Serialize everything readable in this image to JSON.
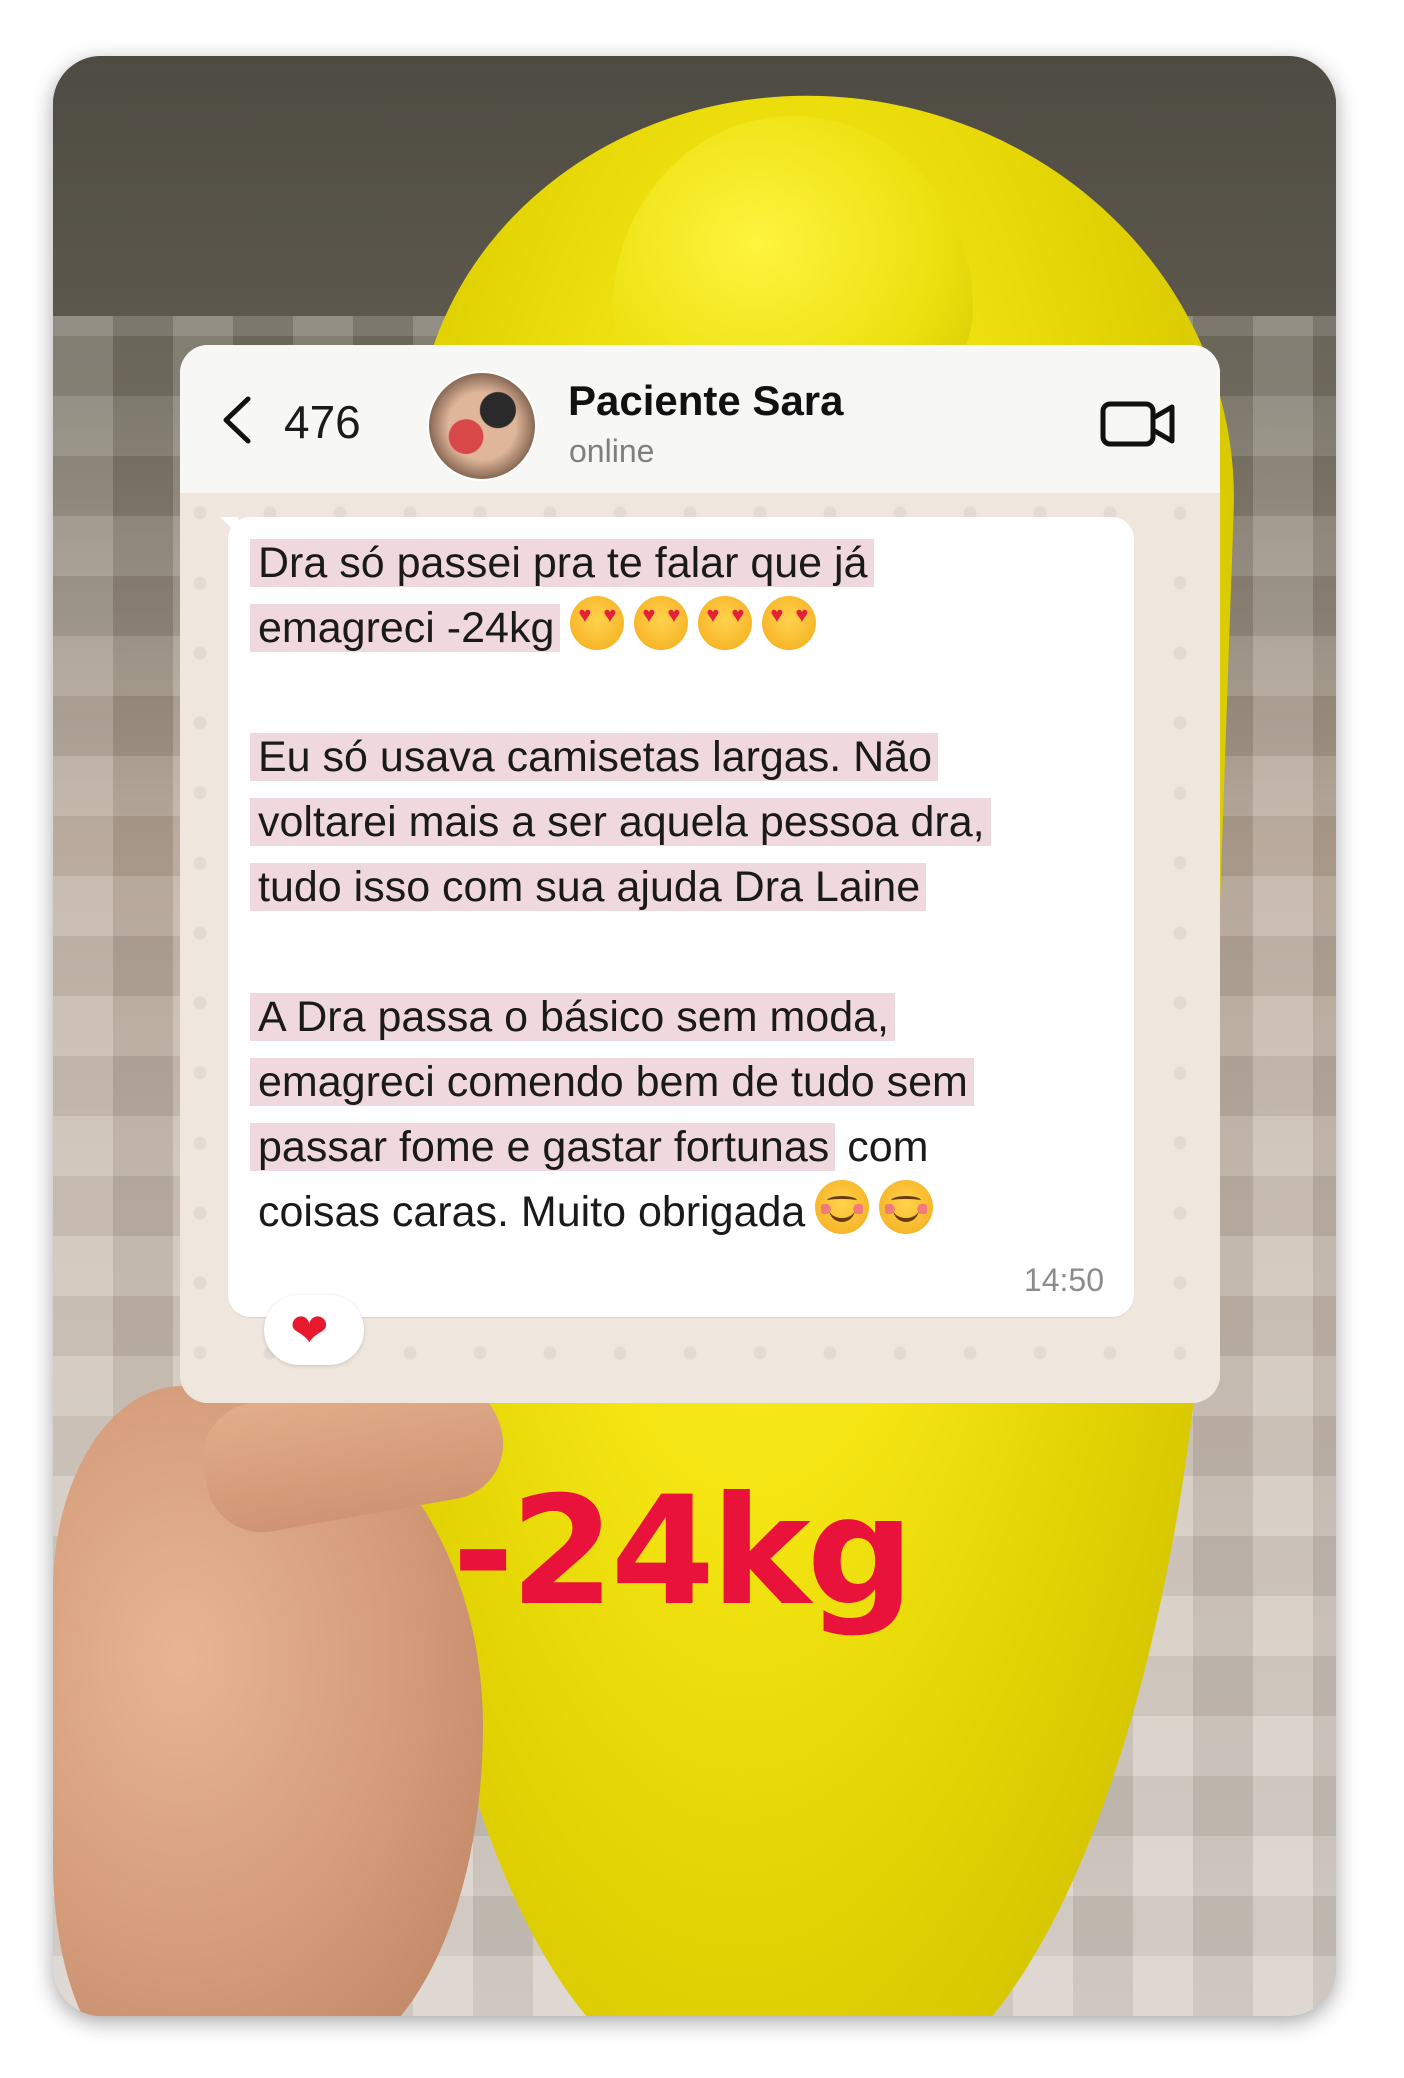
{
  "header": {
    "back_count": "476",
    "contact_name": "Paciente Sara",
    "status": "online"
  },
  "message": {
    "paragraph1": {
      "line1": "Dra só passei pra te falar que já",
      "line2": "emagreci -24kg"
    },
    "paragraph2": {
      "line1": "Eu só usava camisetas largas. Não",
      "line2": "voltarei mais a ser aquela pessoa dra,",
      "line3": "tudo isso com sua ajuda Dra Laine"
    },
    "paragraph3": {
      "line1": "A Dra passa o básico sem moda,",
      "line2": "emagreci comendo bem de tudo sem",
      "line3_highlighted": "passar fome e gastar fortunas",
      "line3_rest": " com",
      "line4": "coisas caras. Muito obrigada"
    },
    "emojis_line1": [
      "heart-eyes",
      "heart-eyes",
      "heart-eyes",
      "heart-eyes"
    ],
    "emojis_end": [
      "smiling-blush",
      "smiling-blush"
    ],
    "time": "14:50",
    "reaction": "❤"
  },
  "overlay": {
    "weight_label": "-24kg"
  },
  "colors": {
    "highlight": "#f0d9de",
    "overlay_text": "#e8123a",
    "reaction_heart": "#e6192e"
  }
}
